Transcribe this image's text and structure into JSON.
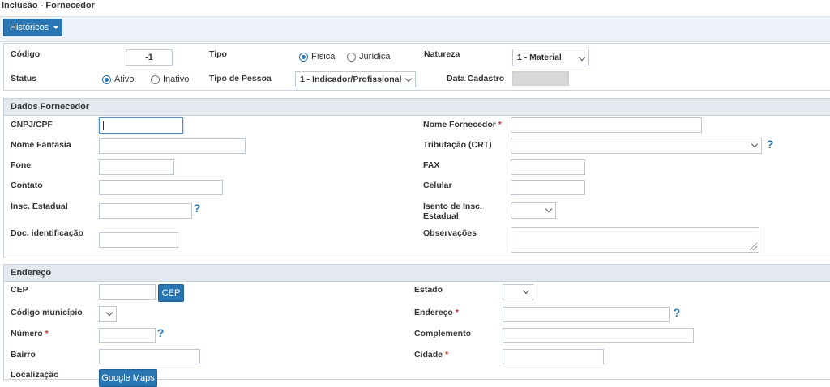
{
  "page": {
    "title": "Inclusão - Fornecedor"
  },
  "toolbar": {
    "historicos_label": "Históricos"
  },
  "header": {
    "codigo_label": "Código",
    "codigo_value": "-1",
    "tipo_label": "Tipo",
    "tipo_options": [
      "Física",
      "Jurídica"
    ],
    "tipo_selected": "Física",
    "natureza_label": "Natureza",
    "natureza_value": "1 - Material",
    "status_label": "Status",
    "status_options": [
      "Ativo",
      "Inativo"
    ],
    "status_selected": "Ativo",
    "tipo_pessoa_label": "Tipo de Pessoa",
    "tipo_pessoa_value": "1 - Indicador/Profissional",
    "data_cadastro_label": "Data Cadastro"
  },
  "dados_fornecedor": {
    "section_title": "Dados Fornecedor",
    "cnpj_label": "CNPJ/CPF",
    "nome_fornecedor_label": "Nome Fornecedor",
    "nome_fantasia_label": "Nome Fantasia",
    "tributacao_label": "Tributação (CRT)",
    "fone_label": "Fone",
    "fax_label": "FAX",
    "contato_label": "Contato",
    "celular_label": "Celular",
    "insc_estadual_label": "Insc. Estadual",
    "isento_label": "Isento de Insc. Estadual",
    "doc_identificacao_label": "Doc. identificação",
    "observacoes_label": "Observações",
    "required_mark": "*"
  },
  "endereco": {
    "section_title": "Endereço",
    "cep_label": "CEP",
    "cep_button": "CEP",
    "estado_label": "Estado",
    "codigo_municipio_label": "Código município",
    "endereco_label": "Endereço",
    "numero_label": "Número",
    "complemento_label": "Complemento",
    "bairro_label": "Bairro",
    "cidade_label": "Cidade",
    "localizacao_label": "Localização",
    "google_maps_button": "Google Maps",
    "required_mark": "*"
  },
  "colors": {
    "accent": "#2a76b3",
    "required": "#c0392b",
    "section_bg": "#e4e9ef"
  },
  "icons": {
    "help": "question-mark-icon",
    "dropdown": "chevron-down-icon",
    "resize": "resize-grip-icon"
  }
}
